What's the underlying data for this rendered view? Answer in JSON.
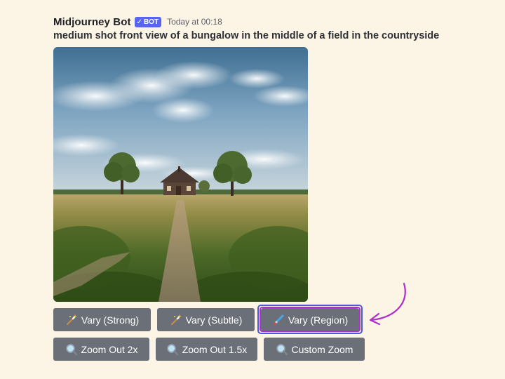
{
  "message": {
    "author": "Midjourney Bot",
    "badge": "BOT",
    "timestamp": "Today at 00:18",
    "prompt": "medium shot front view of a bungalow in the middle of a field in the countryside"
  },
  "buttons": {
    "row1": [
      {
        "label": "Vary (Strong)",
        "icon": "magic-wand-icon"
      },
      {
        "label": "Vary (Subtle)",
        "icon": "magic-wand-icon"
      },
      {
        "label": "Vary (Region)",
        "icon": "paintbrush-icon"
      }
    ],
    "row2": [
      {
        "label": "Zoom Out 2x",
        "icon": "magnifier-icon"
      },
      {
        "label": "Zoom Out 1.5x",
        "icon": "magnifier-icon"
      },
      {
        "label": "Custom Zoom",
        "icon": "magnifier-icon"
      }
    ]
  },
  "colors": {
    "background": "#fcf5e6",
    "button": "#6b6f78",
    "bot_badge": "#5865f2",
    "highlight_outer": "#4f56e0",
    "highlight_inner": "#b02ecb",
    "arrow": "#b02ecb"
  }
}
